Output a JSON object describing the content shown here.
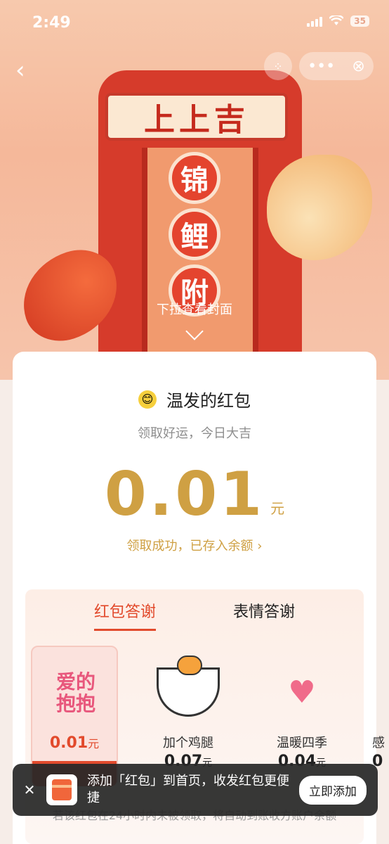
{
  "status_bar": {
    "time": "2:49",
    "battery": "35"
  },
  "hero": {
    "scroll_title": "上上吉",
    "vertical_chars": [
      "锦",
      "鲤",
      "附"
    ],
    "pull_hint": "下拉查看封面"
  },
  "card": {
    "sender_name": "温发的红包",
    "wish": "领取好运，今日大吉",
    "amount": "0.01",
    "unit": "元",
    "stored_text": "领取成功，已存入余额 ›"
  },
  "thanks": {
    "tabs": [
      "红包答谢",
      "表情答谢"
    ],
    "stickers": [
      {
        "art": "爱的\n抱抱",
        "price": "0.01",
        "unit": "元"
      },
      {
        "label": "加个鸡腿",
        "price": "0.07",
        "unit": "元"
      },
      {
        "label": "温暖四季",
        "price": "0.04",
        "unit": "元"
      },
      {
        "label": "感",
        "price": "0"
      }
    ],
    "footer_note": "若该红包在24小时内未被领取，将自动到账收方账户余额"
  },
  "toast": {
    "text": "添加「红包」到首页，收发红包更便捷",
    "button": "立即添加"
  },
  "colors": {
    "accent": "#e24a2c",
    "gold": "#cfa043"
  }
}
